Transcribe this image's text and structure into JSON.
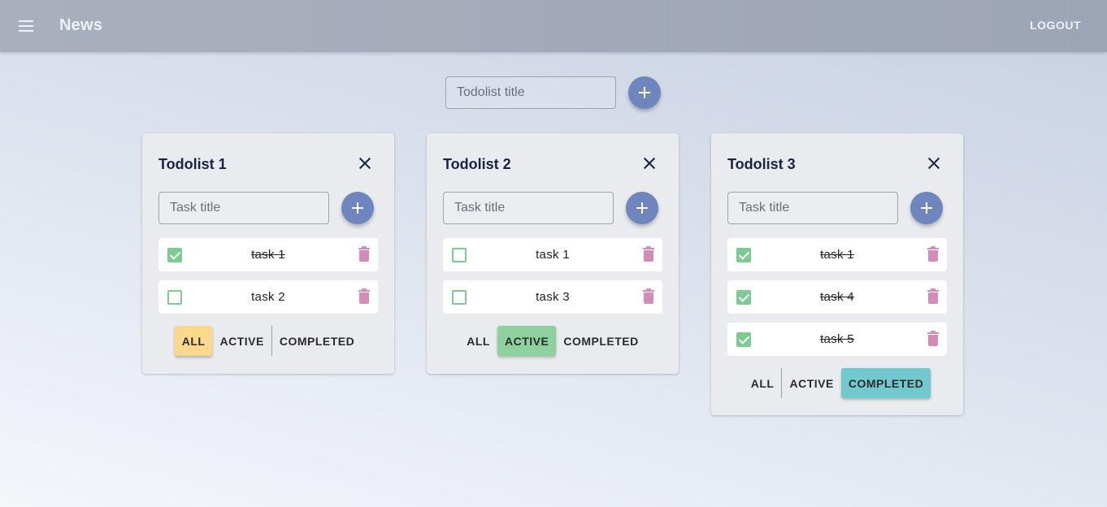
{
  "app": {
    "title": "News",
    "logout_label": "LOGOUT"
  },
  "new_list": {
    "placeholder": "Todolist title"
  },
  "todolists": [
    {
      "title": "Todolist 1",
      "task_placeholder": "Task title",
      "tasks": [
        {
          "label": "task 1",
          "done": true
        },
        {
          "label": "task 2",
          "done": false
        }
      ],
      "filters": {
        "all": "ALL",
        "active": "ACTIVE",
        "completed": "COMPLETED"
      },
      "selected_filter": "all"
    },
    {
      "title": "Todolist 2",
      "task_placeholder": "Task title",
      "tasks": [
        {
          "label": "task 1",
          "done": false
        },
        {
          "label": "task 3",
          "done": false
        }
      ],
      "filters": {
        "all": "ALL",
        "active": "ACTIVE",
        "completed": "COMPLETED"
      },
      "selected_filter": "active"
    },
    {
      "title": "Todolist 3",
      "task_placeholder": "Task title",
      "tasks": [
        {
          "label": "task 1",
          "done": true
        },
        {
          "label": "task 4",
          "done": true
        },
        {
          "label": "task 5",
          "done": true
        }
      ],
      "filters": {
        "all": "ALL",
        "active": "ACTIVE",
        "completed": "COMPLETED"
      },
      "selected_filter": "completed"
    }
  ],
  "colors": {
    "appbar": "#a2aab9",
    "fab": "#6e86bd",
    "checkbox": "#7ccb93",
    "trash": "#d58bb7",
    "filter_all": "#fbd98c",
    "filter_active": "#8fd19e",
    "filter_completed": "#72c9cd"
  }
}
